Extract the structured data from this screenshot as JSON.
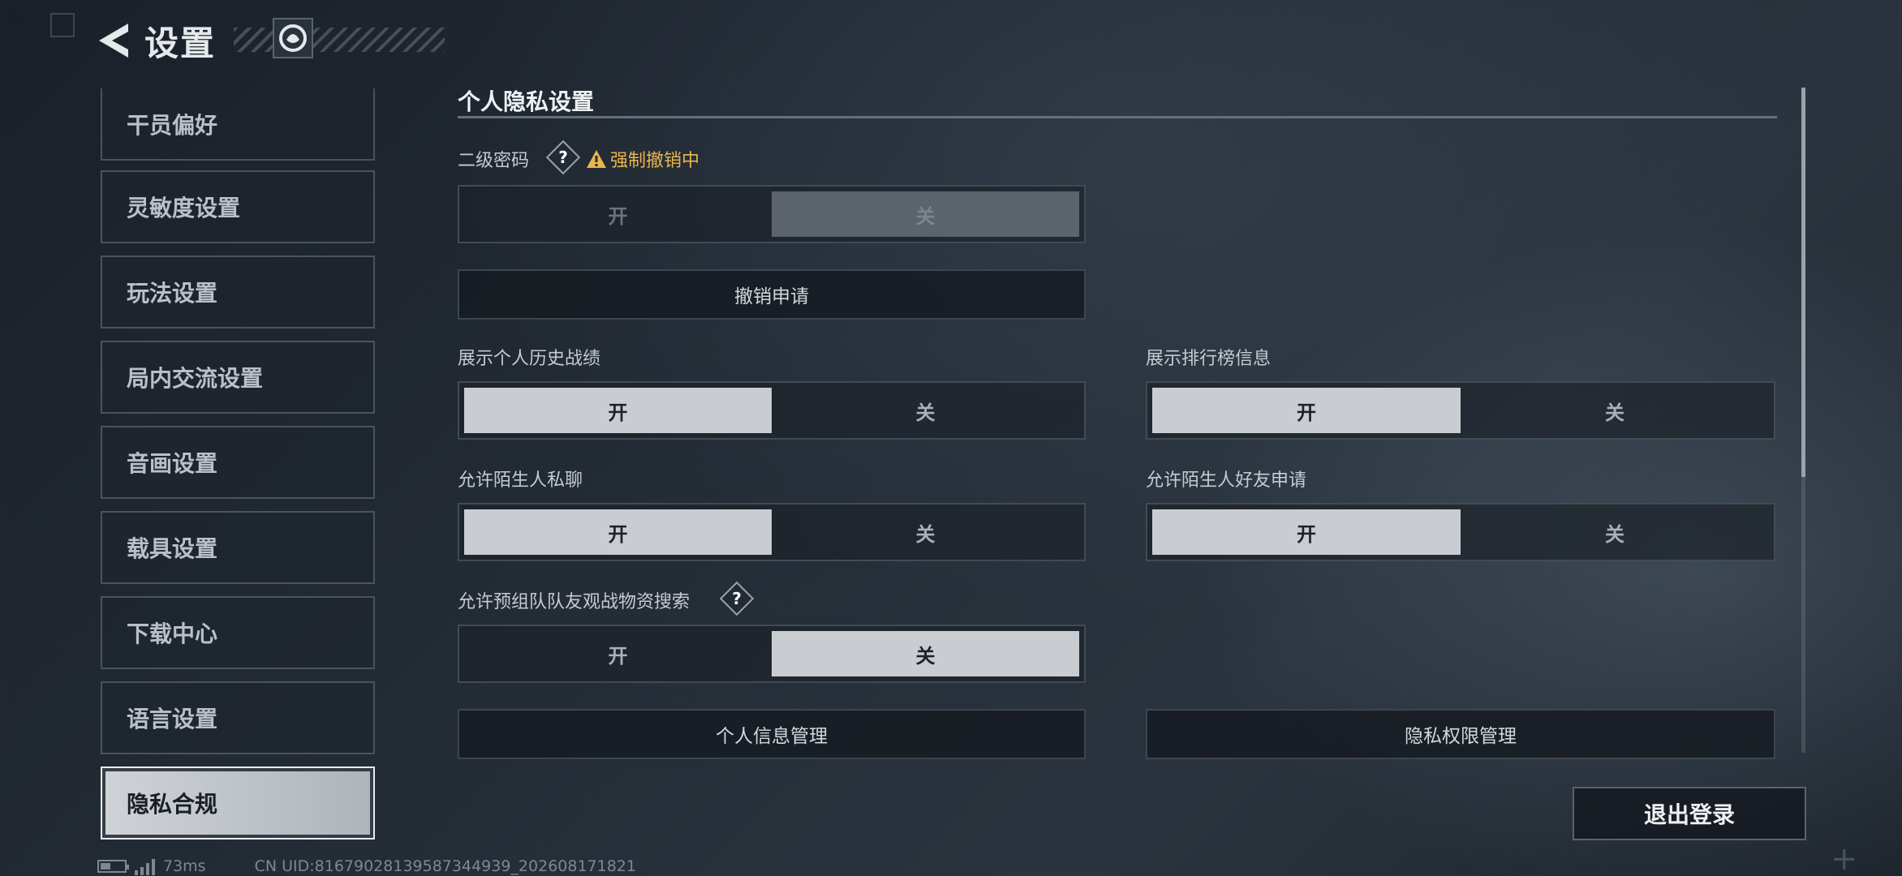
{
  "header": {
    "title": "设置"
  },
  "sidebar": {
    "items": [
      {
        "label": "干员偏好"
      },
      {
        "label": "灵敏度设置"
      },
      {
        "label": "玩法设置"
      },
      {
        "label": "局内交流设置"
      },
      {
        "label": "音画设置"
      },
      {
        "label": "载具设置"
      },
      {
        "label": "下载中心"
      },
      {
        "label": "语言设置"
      },
      {
        "label": "隐私合规"
      }
    ],
    "active_index": 8
  },
  "privacy": {
    "section_title": "个人隐私设置",
    "secondary_password": {
      "label": "二级密码",
      "help": "?",
      "status": "强制撤销中",
      "on_label": "开",
      "off_label": "关",
      "selected": "off"
    },
    "revoke_button": "撤销申请",
    "show_history": {
      "label": "展示个人历史战绩",
      "on_label": "开",
      "off_label": "关",
      "selected": "on"
    },
    "show_leaderboard": {
      "label": "展示排行榜信息",
      "on_label": "开",
      "off_label": "关",
      "selected": "on"
    },
    "stranger_chat": {
      "label": "允许陌生人私聊",
      "on_label": "开",
      "off_label": "关",
      "selected": "on"
    },
    "stranger_friend": {
      "label": "允许陌生人好友申请",
      "on_label": "开",
      "off_label": "关",
      "selected": "on"
    },
    "team_search": {
      "label": "允许预组队队友观战物资搜索",
      "help": "?",
      "on_label": "开",
      "off_label": "关",
      "selected": "off"
    },
    "personal_info_button": "个人信息管理",
    "privacy_permission_button": "隐私权限管理"
  },
  "logout_button": "退出登录",
  "footer": {
    "ping": "73ms",
    "uid": "CN UID:8167902813958734493​9_202608171821"
  },
  "colors": {
    "accent_warning": "#e9b64d",
    "toggle_on": "#c9cdd1",
    "background": "#232b35"
  }
}
